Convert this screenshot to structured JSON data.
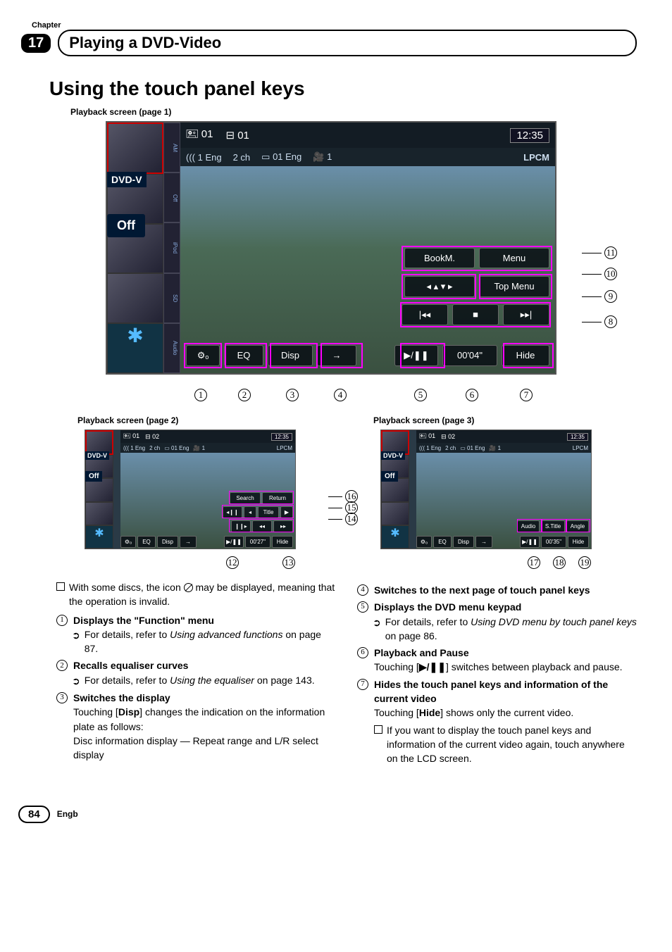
{
  "chapter": {
    "label": "Chapter",
    "number": "17",
    "section_title": "Playing a DVD-Video"
  },
  "heading": "Using the touch panel keys",
  "captions": {
    "page1": "Playback screen (page 1)",
    "page2": "Playback screen (page 2)",
    "page3": "Playback screen (page 3)"
  },
  "ui_large": {
    "top": {
      "disc": "01",
      "chapter": "01",
      "clock": "12:35"
    },
    "second": {
      "audio": "((( 1 Eng",
      "ch": "2 ch",
      "sub": "01 Eng",
      "angle": "1",
      "codec": "LPCM"
    },
    "tabs": {
      "off": "Off",
      "ipod": "iPod",
      "sd": "SD",
      "audio": "Audio"
    },
    "labels": {
      "dvd": "DVD-V",
      "off": "Off"
    },
    "row_bookm": {
      "bookm": "BookM.",
      "menu": "Menu"
    },
    "row_arrow": {
      "arrow": "◂ ▴ ▾ ▸",
      "topmenu": "Top Menu"
    },
    "row_skip": {
      "prev": "|◂◂",
      "stop": "■",
      "next": "▸▸|"
    },
    "row_bottom": {
      "gear": "",
      "eq": "EQ",
      "disp": "Disp",
      "arrow": "→",
      "play": "▶/❚❚",
      "time": "00'04\"",
      "hide": "Hide"
    },
    "callouts_right": [
      "11",
      "10",
      "9",
      "8"
    ],
    "callouts_below": [
      "1",
      "2",
      "3",
      "4",
      "5",
      "6",
      "7"
    ]
  },
  "ui_small2": {
    "top": {
      "disc": "01",
      "chapter": "02",
      "clock": "12:35"
    },
    "second": {
      "audio": "((( 1 Eng",
      "ch": "2 ch",
      "sub": "01 Eng",
      "angle": "1",
      "codec": "LPCM"
    },
    "labels": {
      "dvd": "DVD-V",
      "off": "Off"
    },
    "row_a": {
      "search": "Search",
      "return": "Return"
    },
    "row_b": {
      "slowb": "◂❙❙",
      "tprev": "◂",
      "title": "Title",
      "tnext": "▶"
    },
    "row_c": {
      "step": "❙❙▸",
      "rew": "◂◂",
      "ff": "▸▸"
    },
    "row_bottom": {
      "eq": "EQ",
      "disp": "Disp",
      "arrow": "→",
      "play": "▶/❚❚",
      "time": "00'27\"",
      "hide": "Hide"
    },
    "callouts_right": [
      "16",
      "15",
      "14"
    ],
    "callouts_below": [
      "12",
      "13"
    ]
  },
  "ui_small3": {
    "top": {
      "disc": "01",
      "chapter": "02",
      "clock": "12:35"
    },
    "second": {
      "audio": "((( 1 Eng",
      "ch": "2 ch",
      "sub": "01 Eng",
      "angle": "1",
      "codec": "LPCM"
    },
    "labels": {
      "dvd": "DVD-V",
      "off": "Off"
    },
    "row_a": {
      "audio": "Audio",
      "stitle": "S.Title",
      "angle": "Angle"
    },
    "row_bottom": {
      "eq": "EQ",
      "disp": "Disp",
      "arrow": "→",
      "play": "▶/❚❚",
      "time": "00'35\"",
      "hide": "Hide"
    },
    "callouts_below": [
      "17",
      "18",
      "19"
    ]
  },
  "body": {
    "note_invalid_pre": "With some discs, the icon ",
    "note_invalid_post": " may be displayed, meaning that the operation is invalid.",
    "items": {
      "i1": {
        "title": "Displays the \"Function\" menu",
        "sub_pre": "For details, refer to ",
        "sub_em": "Using advanced functions",
        "sub_post": " on page 87."
      },
      "i2": {
        "title": "Recalls equaliser curves",
        "sub_pre": "For details, refer to ",
        "sub_em": "Using the equaliser",
        "sub_post": " on page 143."
      },
      "i3": {
        "title": "Switches the display",
        "line1a": "Touching [",
        "line1b": "Disp",
        "line1c": "] changes the indication on the information plate as follows:",
        "line2": "Disc information display — Repeat range and L/R select display"
      },
      "i4": {
        "title": "Switches to the next page of touch panel keys"
      },
      "i5": {
        "title": "Displays the DVD menu keypad",
        "sub_pre": "For details, refer to ",
        "sub_em": "Using DVD menu by touch panel keys",
        "sub_post": " on page 86."
      },
      "i6": {
        "title": "Playback and Pause",
        "line1a": "Touching [",
        "line1b": "▶/❚❚",
        "line1c": "] switches between playback and pause."
      },
      "i7": {
        "title": "Hides the touch panel keys and information of the current video",
        "line1a": "Touching [",
        "line1b": "Hide",
        "line1c": "] shows only the current video.",
        "note": "If you want to display the touch panel keys and information of the current video again, touch anywhere on the LCD screen."
      }
    }
  },
  "footer": {
    "page": "84",
    "lang": "Engb"
  }
}
